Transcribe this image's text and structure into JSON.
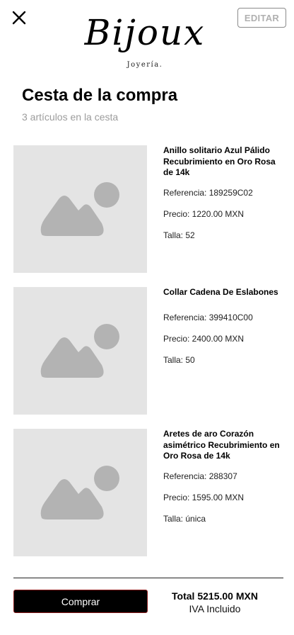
{
  "header": {
    "edit_label": "EDITAR",
    "logo_text": "Bijoux",
    "logo_subtext": "Joyería."
  },
  "cart": {
    "title": "Cesta de la compra",
    "subtitle": "3 artículos en la cesta"
  },
  "items": [
    {
      "name": "Anillo solitario Azul Pálido Recubrimiento en Oro Rosa de 14k",
      "reference": "Referencia: 189259C02",
      "price": "Precio: 1220.00 MXN",
      "size": "Talla: 52"
    },
    {
      "name": "Collar Cadena De Eslabones",
      "reference": "Referencia: 399410C00",
      "price": "Precio: 2400.00 MXN",
      "size": "Talla: 50"
    },
    {
      "name": "Aretes de aro Corazón asimétrico Recubrimiento en Oro Rosa de 14k",
      "reference": "Referencia: 288307",
      "price": "Precio: 1595.00 MXN",
      "size": "Talla: única"
    }
  ],
  "footer": {
    "buy_label": "Comprar",
    "total": "Total 5215.00 MXN",
    "tax_note": "IVA Incluido"
  },
  "icons": {
    "close": "close-icon",
    "image_placeholder": "image-placeholder-icon"
  },
  "colors": {
    "placeholder_bg": "#e4e4e4",
    "placeholder_glyph": "#b3b3b3",
    "subtitle": "#9c9c9c",
    "buy_button_bg": "#000000",
    "buy_button_border": "#8b1a1a"
  }
}
